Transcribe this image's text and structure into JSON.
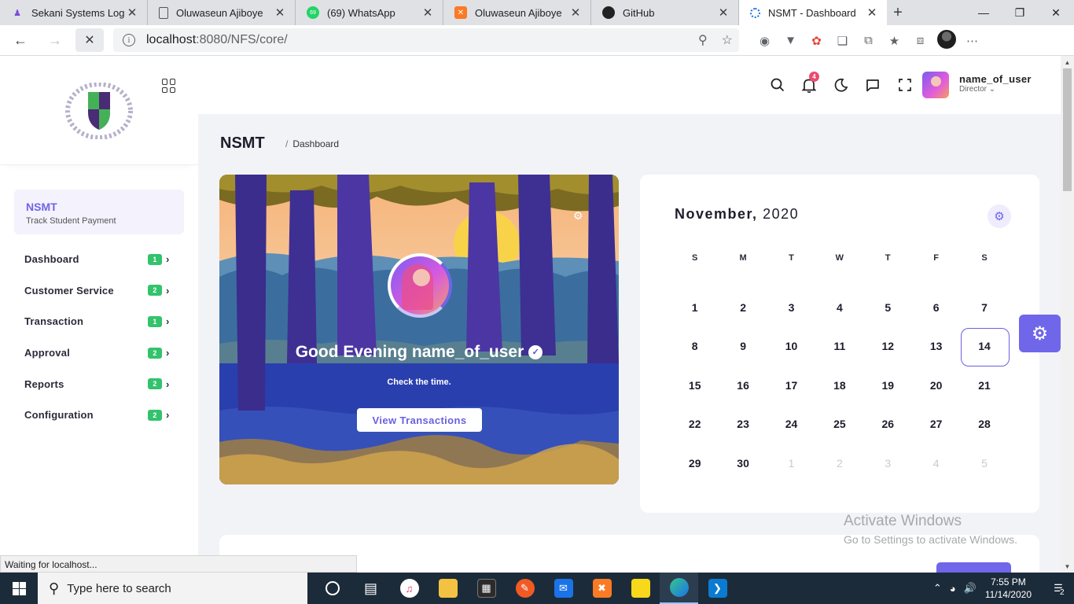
{
  "browser": {
    "tabs": [
      {
        "title": "Sekani Systems Login",
        "favicon": "sekani-icon"
      },
      {
        "title": "Oluwaseun Ajiboye",
        "favicon": "page-icon"
      },
      {
        "title": "(69) WhatsApp",
        "favicon": "whatsapp-icon"
      },
      {
        "title": "Oluwaseun Ajiboye",
        "favicon": "xampp-icon"
      },
      {
        "title": "GitHub",
        "favicon": "github-icon"
      },
      {
        "title": "NSMT - Dashboard",
        "favicon": "loading-icon",
        "active": true
      }
    ],
    "url_host": "localhost",
    "url_path": ":8080/NFS/core/",
    "status_text": "Waiting for localhost..."
  },
  "sidebar": {
    "card_title": "NSMT",
    "card_subtitle": "Track Student Payment",
    "items": [
      {
        "label": "Dashboard",
        "badge": "1"
      },
      {
        "label": "Customer Service",
        "badge": "2"
      },
      {
        "label": "Transaction",
        "badge": "1"
      },
      {
        "label": "Approval",
        "badge": "2"
      },
      {
        "label": "Reports",
        "badge": "2"
      },
      {
        "label": "Configuration",
        "badge": "2"
      }
    ]
  },
  "header": {
    "notification_count": "4",
    "user_name": "name_of_user",
    "user_role": "Director"
  },
  "main": {
    "page_title": "NSMT",
    "breadcrumb_sep": "/",
    "breadcrumb": "Dashboard",
    "hero": {
      "greeting": "Good Evening name_of_user",
      "subtitle": "Check the time.",
      "button": "View Transactions"
    },
    "calendar": {
      "month": "November,",
      "year": "2020",
      "weekdays": [
        "S",
        "M",
        "T",
        "W",
        "T",
        "F",
        "S"
      ],
      "weeks": [
        [
          "1",
          "2",
          "3",
          "4",
          "5",
          "6",
          "7"
        ],
        [
          "8",
          "9",
          "10",
          "11",
          "12",
          "13",
          "14"
        ],
        [
          "15",
          "16",
          "17",
          "18",
          "19",
          "20",
          "21"
        ],
        [
          "22",
          "23",
          "24",
          "25",
          "26",
          "27",
          "28"
        ],
        [
          "29",
          "30",
          "1",
          "2",
          "3",
          "4",
          "5"
        ]
      ],
      "today": "14",
      "accent_color": "#6a60e0"
    }
  },
  "watermark": {
    "line1": "Activate Windows",
    "line2": "Go to Settings to activate Windows."
  },
  "taskbar": {
    "search_placeholder": "Type here to search",
    "time": "7:55 PM",
    "date": "11/14/2020",
    "notifications": "2"
  }
}
